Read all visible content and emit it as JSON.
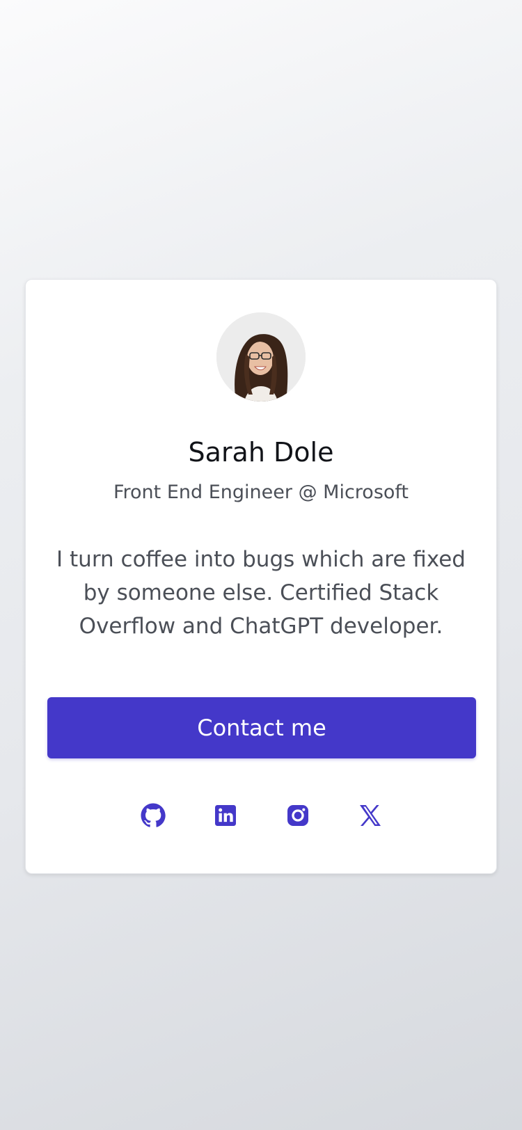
{
  "profile": {
    "name": "Sarah Dole",
    "title": "Front End Engineer @ Microsoft",
    "bio": "I turn coffee into bugs which are fixed by someone else. Certified Stack Overflow and ChatGPT developer."
  },
  "actions": {
    "contact_label": "Contact me"
  },
  "socials": [
    {
      "icon": "github-icon"
    },
    {
      "icon": "linkedin-icon"
    },
    {
      "icon": "instagram-icon"
    },
    {
      "icon": "x-twitter-icon"
    }
  ],
  "colors": {
    "accent": "#4438c9",
    "card_bg": "#ffffff",
    "name_text": "#111318",
    "muted_text": "#4b4f57"
  }
}
